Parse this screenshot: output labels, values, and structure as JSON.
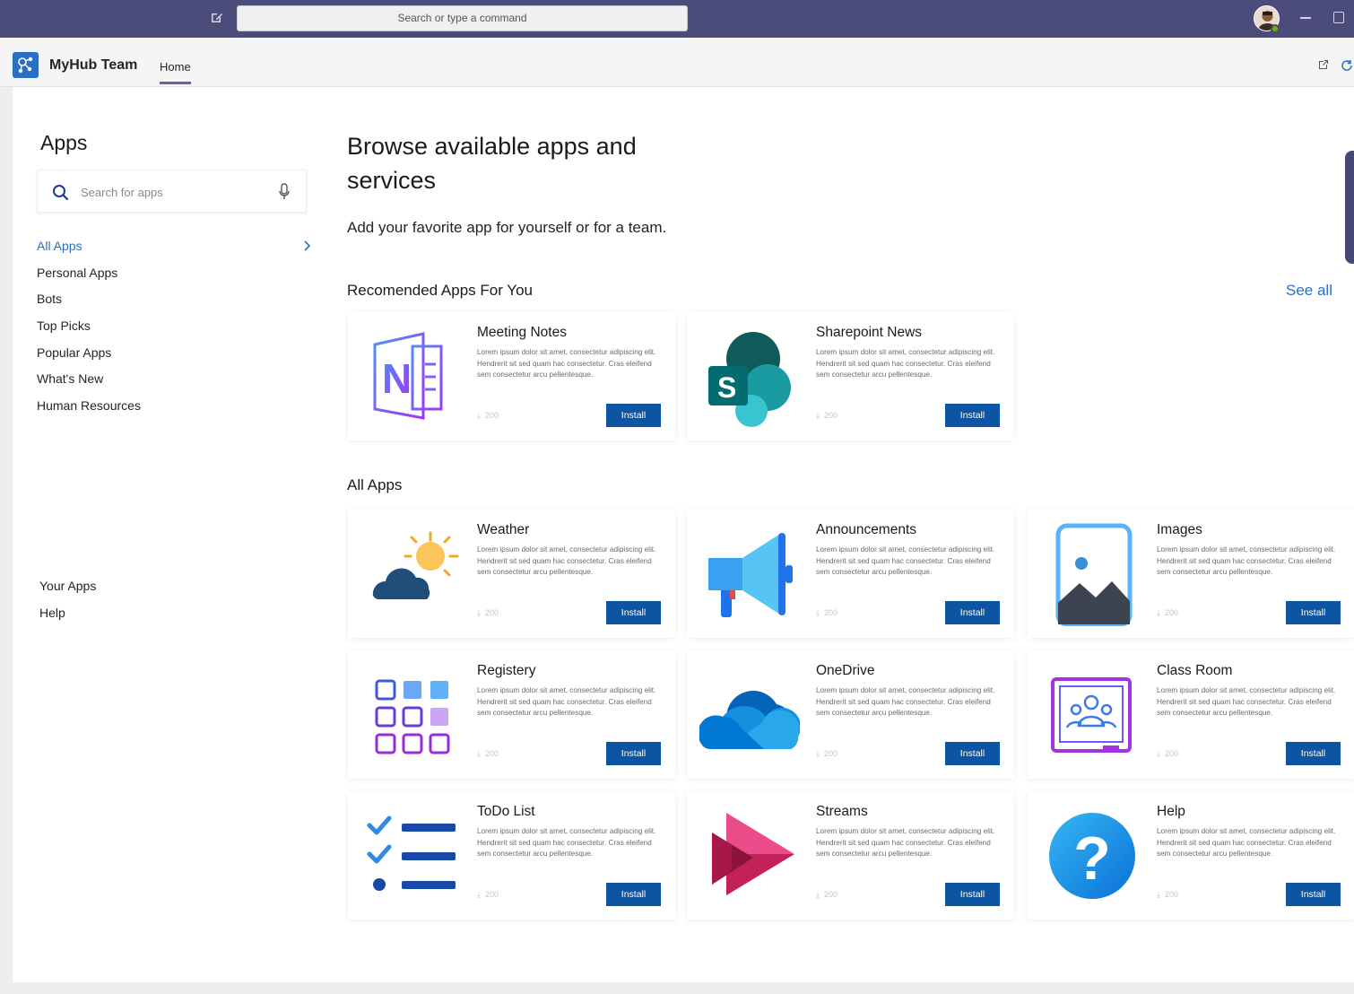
{
  "topbar": {
    "search_placeholder": "Search or type a command"
  },
  "appbar": {
    "app_name": "MyHub Team",
    "tab_home": "Home"
  },
  "sidebar": {
    "title": "Apps",
    "search_placeholder": "Search for apps",
    "nav": [
      {
        "label": "All Apps",
        "active": true
      },
      {
        "label": "Personal Apps"
      },
      {
        "label": "Bots"
      },
      {
        "label": "Top Picks"
      },
      {
        "label": "Popular Apps"
      },
      {
        "label": "What's New"
      },
      {
        "label": "Human Resources"
      }
    ],
    "bottom": [
      "Your Apps",
      "Help"
    ]
  },
  "main": {
    "title": "Browse available apps and services",
    "subtitle": "Add your favorite app for yourself or for a team.",
    "recommended_title": "Recomended Apps For You",
    "see_all": "See all",
    "all_apps_title": "All Apps",
    "description": "Lorem ipsum dolor sit amet, consectetur adipiscing elit. Hendrerit sit sed quam hac consectetur. Cras eleifend sem consectetur arcu pellentesque.",
    "install_label": "Install",
    "recommended": [
      {
        "name": "Meeting Notes",
        "count": "200",
        "icon": "onenote-icon"
      },
      {
        "name": "Sharepoint News",
        "count": "200",
        "icon": "sharepoint-icon"
      }
    ],
    "apps": [
      {
        "name": "Weather",
        "count": "200",
        "icon": "weather-icon"
      },
      {
        "name": "Announcements",
        "count": "200",
        "icon": "megaphone-icon"
      },
      {
        "name": "Images",
        "count": "200",
        "icon": "image-icon"
      },
      {
        "name": "Registery",
        "count": "200",
        "icon": "grid-icon"
      },
      {
        "name": "OneDrive",
        "count": "200",
        "icon": "onedrive-icon"
      },
      {
        "name": "Class Room",
        "count": "200",
        "icon": "classroom-icon"
      },
      {
        "name": "ToDo List",
        "count": "200",
        "icon": "checklist-icon"
      },
      {
        "name": "Streams",
        "count": "200",
        "icon": "streams-icon"
      },
      {
        "name": "Help",
        "count": "200",
        "icon": "help-icon"
      }
    ]
  }
}
